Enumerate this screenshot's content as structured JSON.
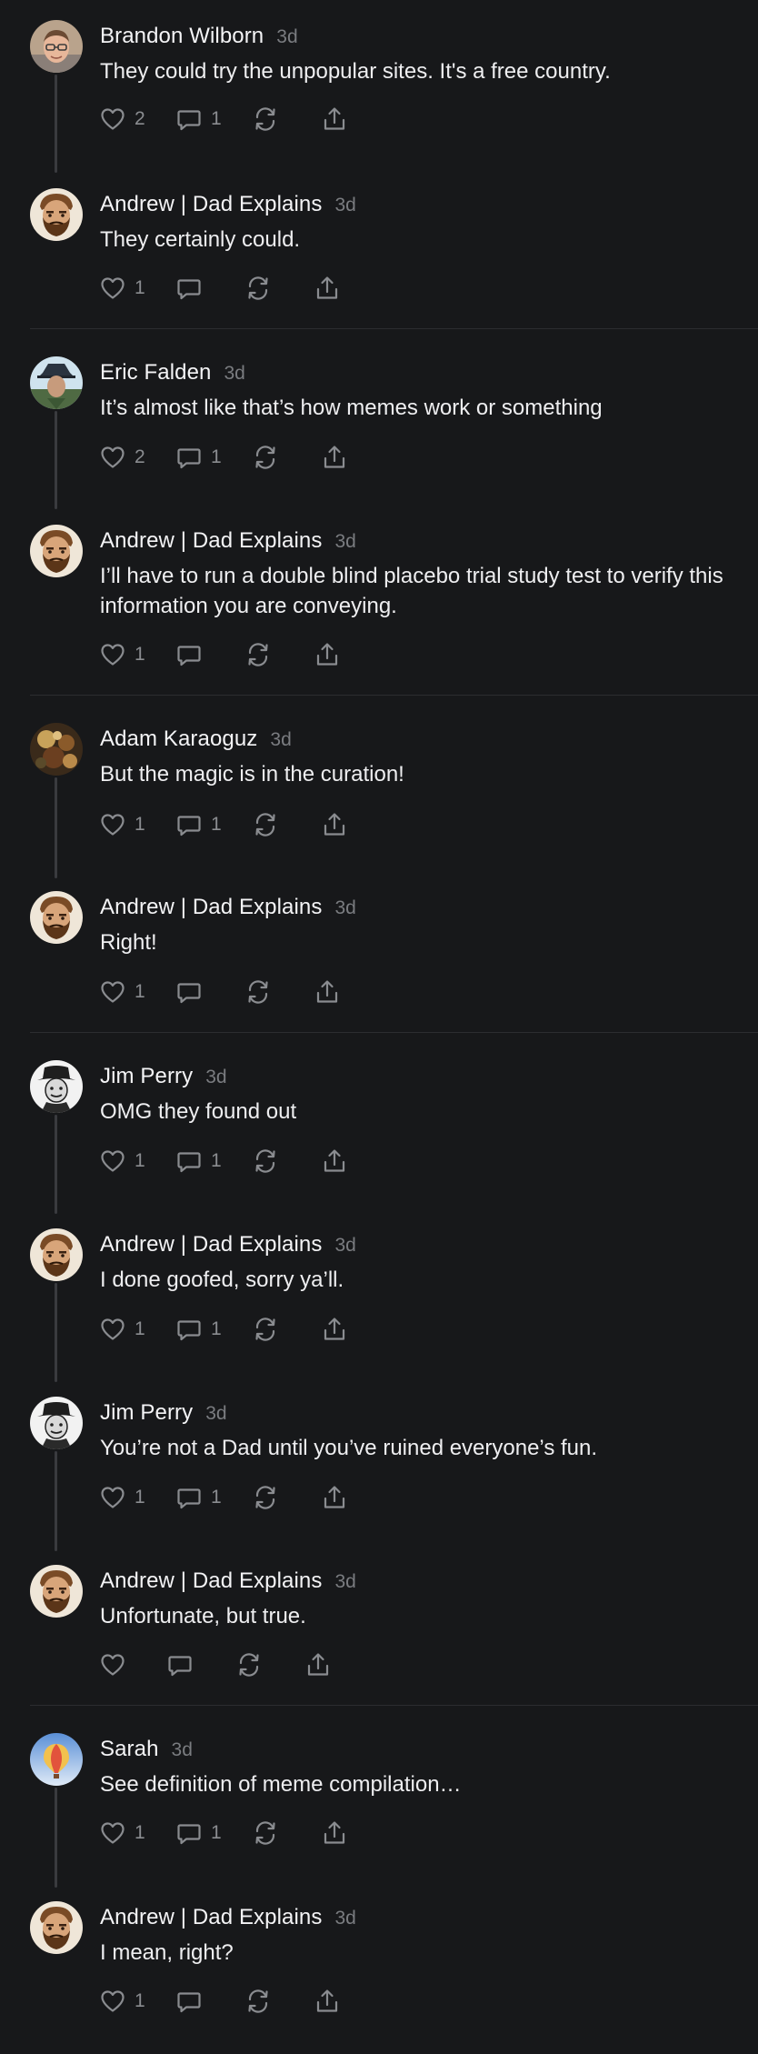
{
  "comments": [
    {
      "author": "Brandon Wilborn",
      "time": "3d",
      "text": "They could try the unpopular sites. It's a free country.",
      "likes": "2",
      "replies": "1",
      "avatar_icon": "brandon-avatar"
    },
    {
      "author": "Andrew | Dad Explains",
      "time": "3d",
      "text": "They certainly could.",
      "likes": "1",
      "replies": "",
      "avatar_icon": "andrew-avatar"
    },
    {
      "author": "Eric Falden",
      "time": "3d",
      "text": "It’s almost like that’s how memes work or something",
      "likes": "2",
      "replies": "1",
      "avatar_icon": "eric-avatar"
    },
    {
      "author": "Andrew | Dad Explains",
      "time": "3d",
      "text": "I’ll have to run a double blind placebo trial study test to verify this information you are conveying.",
      "likes": "1",
      "replies": "",
      "avatar_icon": "andrew-avatar"
    },
    {
      "author": "Adam Karaoguz",
      "time": "3d",
      "text": "But the magic is in the curation!",
      "likes": "1",
      "replies": "1",
      "avatar_icon": "adam-avatar"
    },
    {
      "author": "Andrew | Dad Explains",
      "time": "3d",
      "text": "Right!",
      "likes": "1",
      "replies": "",
      "avatar_icon": "andrew-avatar"
    },
    {
      "author": "Jim Perry",
      "time": "3d",
      "text": "OMG they found out",
      "likes": "1",
      "replies": "1",
      "avatar_icon": "jim-avatar"
    },
    {
      "author": "Andrew | Dad Explains",
      "time": "3d",
      "text": "I done goofed, sorry ya’ll.",
      "likes": "1",
      "replies": "1",
      "avatar_icon": "andrew-avatar"
    },
    {
      "author": "Jim Perry",
      "time": "3d",
      "text": "You’re not a Dad until you’ve ruined everyone’s fun.",
      "likes": "1",
      "replies": "1",
      "avatar_icon": "jim-avatar"
    },
    {
      "author": "Andrew | Dad Explains",
      "time": "3d",
      "text": "Unfortunate, but true.",
      "likes": "",
      "replies": "",
      "avatar_icon": "andrew-avatar"
    },
    {
      "author": "Sarah",
      "time": "3d",
      "text": "See definition of meme compilation…",
      "likes": "1",
      "replies": "1",
      "avatar_icon": "sarah-avatar"
    },
    {
      "author": "Andrew | Dad Explains",
      "time": "3d",
      "text": "I mean, right?",
      "likes": "1",
      "replies": "",
      "avatar_icon": "andrew-avatar"
    }
  ],
  "icons": {
    "like": "heart-icon",
    "reply": "speech-bubble-icon",
    "restack": "restack-icon",
    "share": "share-icon"
  },
  "colors": {
    "background": "#17181a",
    "text": "#f2f2f3",
    "muted": "#7a7c80",
    "thread_line": "#3a3b3f"
  }
}
